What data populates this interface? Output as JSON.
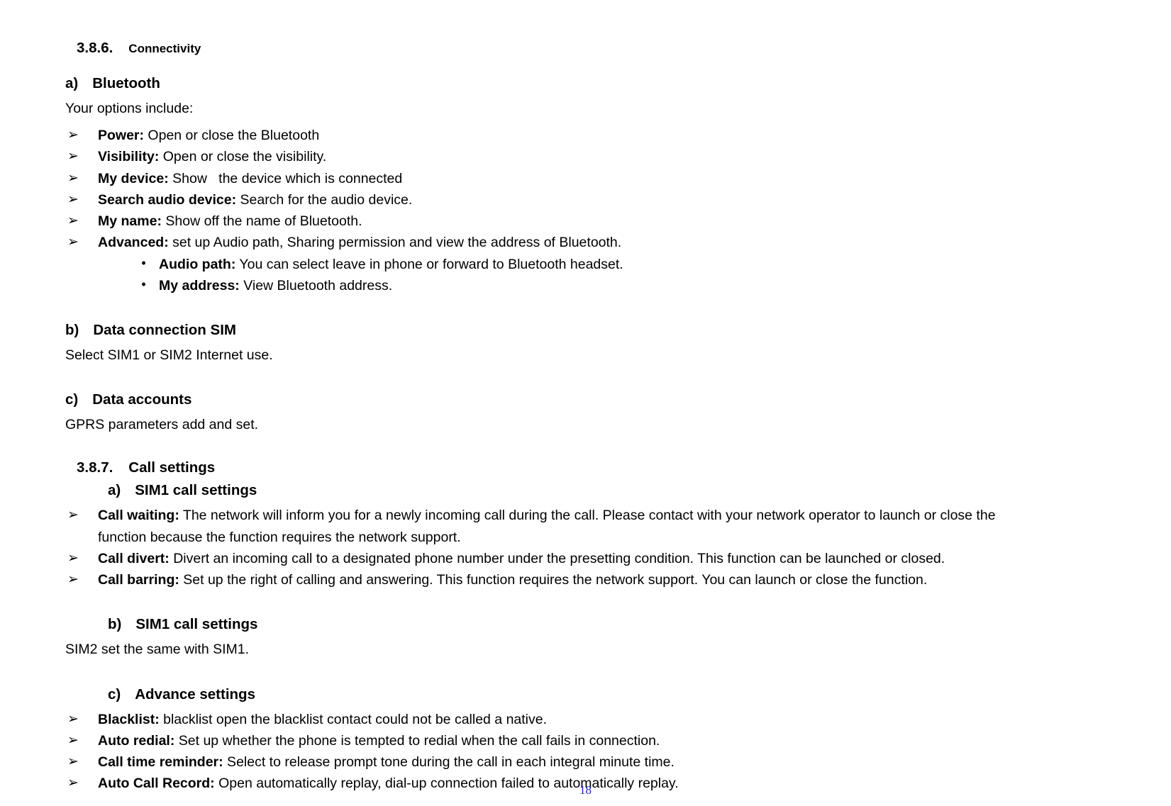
{
  "document": {
    "page_number": "18",
    "page_number_color": "#2222cc"
  },
  "sections": [
    {
      "number": "3.8.6.",
      "title": "Connectivity"
    },
    {
      "number": "3.8.7.",
      "title": "Call settings"
    }
  ],
  "connectivity": {
    "heading_number": "3.8.6.",
    "heading_title": "Connectivity",
    "item_a": {
      "marker": "a)",
      "title": "Bluetooth",
      "intro": "Your options include:",
      "bullets": [
        {
          "marker": "➢",
          "term": "Power:",
          "desc": " Open or close the Bluetooth"
        },
        {
          "marker": "➢",
          "term": "Visibility:",
          "desc": " Open or close the visibility."
        },
        {
          "marker": "➢",
          "term": "My device:",
          "desc": " Show   the device which is connected"
        },
        {
          "marker": "➢",
          "term": "Search audio device:",
          "desc": " Search for the audio device."
        },
        {
          "marker": "➢",
          "term": "My name:",
          "desc": " Show off the name of Bluetooth."
        },
        {
          "marker": "➢",
          "term": "Advanced:",
          "desc": " set up Audio path, Sharing permission and view the address of Bluetooth."
        }
      ],
      "sub_bullets": [
        {
          "marker": "•",
          "term": "Audio path:",
          "desc": " You can select leave in phone or forward to Bluetooth headset."
        },
        {
          "marker": "•",
          "term": "My address:",
          "desc": " View Bluetooth address."
        }
      ]
    },
    "item_b": {
      "marker": "b)",
      "title": "Data connection SIM",
      "text": "Select SIM1 or SIM2 Internet use."
    },
    "item_c": {
      "marker": "c)",
      "title": "Data accounts",
      "text": "GPRS parameters add and set."
    }
  },
  "call_settings": {
    "heading_number": "3.8.7.",
    "heading_title": "Call settings",
    "item_a": {
      "marker": "a)",
      "title": "SIM1 call settings",
      "bullets": [
        {
          "marker": "➢",
          "term": "Call waiting:",
          "desc": " The network will inform you for a newly incoming call during the call. Please contact with your network operator to launch or close the function because the function requires the network support."
        },
        {
          "marker": "➢",
          "term": "Call divert:",
          "desc": " Divert an incoming call to a designated phone number under the presetting condition. This function can be launched or closed."
        },
        {
          "marker": "➢",
          "term": "Call barring:",
          "desc": " Set up the right of calling and answering. This function requires the network support. You can launch or close the function."
        }
      ]
    },
    "item_b": {
      "marker": "b)",
      "title": "SIM1 call settings",
      "text": "SIM2 set the same with SIM1."
    },
    "item_c": {
      "marker": "c)",
      "title": "Advance settings",
      "bullets": [
        {
          "marker": "➢",
          "term": "Blacklist:",
          "desc": " blacklist open the blacklist contact could not be called a native."
        },
        {
          "marker": "➢",
          "term": "Auto redial:",
          "desc": " Set up whether the phone is tempted to redial when the call fails in connection."
        },
        {
          "marker": "➢",
          "term": "Call time reminder:",
          "desc": " Select to release prompt tone during the call in each integral minute time."
        },
        {
          "marker": "➢",
          "term": "Auto Call Record:",
          "desc": " Open automatically replay, dial-up connection failed to automatically replay."
        }
      ]
    }
  }
}
